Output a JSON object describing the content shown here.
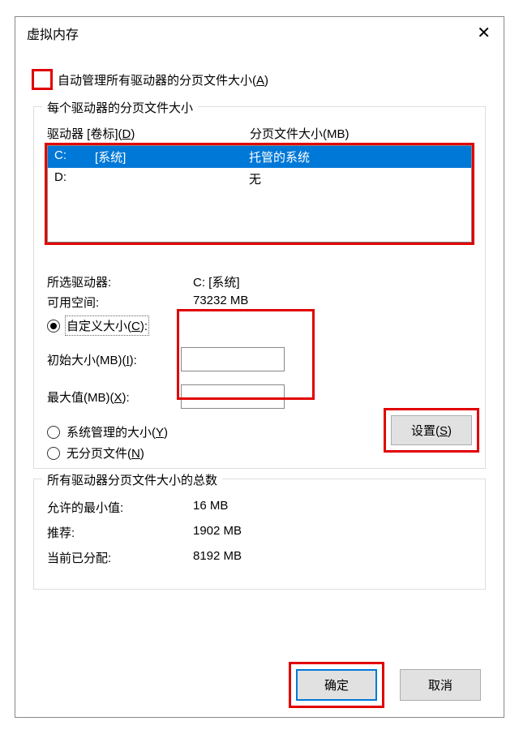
{
  "window": {
    "title": "虚拟内存",
    "close_symbol": "✕"
  },
  "auto_manage": {
    "label_before": "自动管理所有驱动器的分页文件大小(",
    "accel": "A",
    "label_after": ")"
  },
  "group_drives": {
    "title": "每个驱动器的分页文件大小",
    "header_drive_before": "驱动器 [卷标](",
    "header_drive_accel": "D",
    "header_drive_after": ")",
    "header_size": "分页文件大小(MB)",
    "rows": [
      {
        "letter": "C:",
        "label": "[系统]",
        "size": "托管的系统",
        "selected": true
      },
      {
        "letter": "D:",
        "label": "",
        "size": "无",
        "selected": false
      }
    ]
  },
  "selected_drive": {
    "drive_label": "所选驱动器:",
    "drive_value": "C:  [系统]",
    "free_label": "可用空间:",
    "free_value": "73232 MB"
  },
  "radios": {
    "custom_before": "自定义大小(",
    "custom_accel": "C",
    "custom_after": "):",
    "initial_before": "初始大小(MB)(",
    "initial_accel": "I",
    "initial_after": "):",
    "max_before": "最大值(MB)(",
    "max_accel": "X",
    "max_after": "):",
    "system_before": "系统管理的大小(",
    "system_accel": "Y",
    "system_after": ")",
    "none_before": "无分页文件(",
    "none_accel": "N",
    "none_after": ")"
  },
  "set_button_before": "设置(",
  "set_button_accel": "S",
  "set_button_after": ")",
  "group_totals": {
    "title": "所有驱动器分页文件大小的总数",
    "min_label": "允许的最小值:",
    "min_value": "16 MB",
    "rec_label": "推荐:",
    "rec_value": "1902 MB",
    "cur_label": "当前已分配:",
    "cur_value": "8192 MB"
  },
  "buttons": {
    "ok": "确定",
    "cancel": "取消"
  }
}
